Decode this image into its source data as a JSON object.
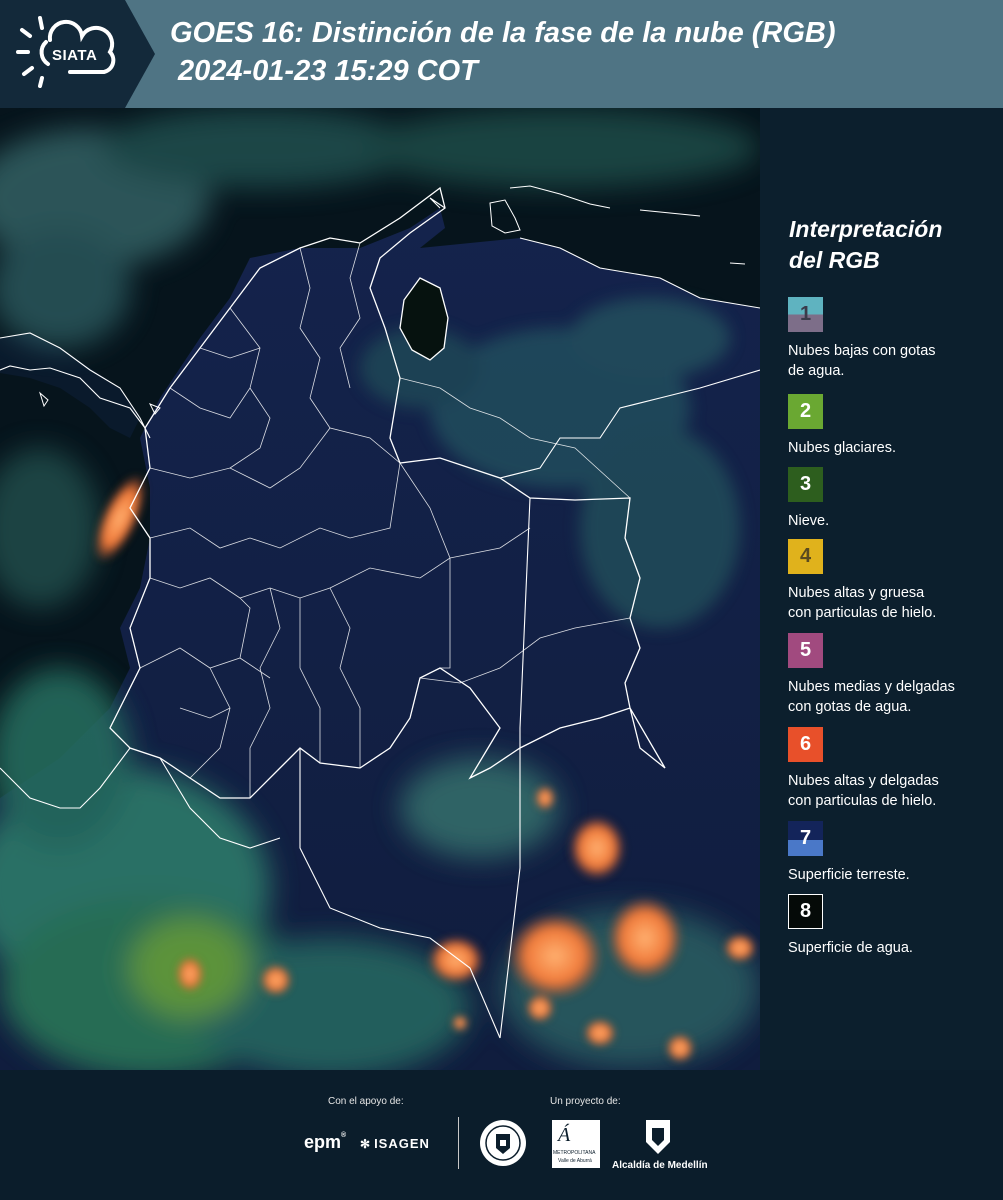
{
  "header": {
    "logo_text": "SIATA",
    "title_line1": "GOES 16: Distinción de la fase de la nube (RGB)",
    "title_line2": "2024-01-23 15:29 COT"
  },
  "legend": {
    "title_line1": "Interpretación",
    "title_line2": "del RGB",
    "items": [
      {
        "number": "1",
        "label_line1": "Nubes bajas con gotas",
        "label_line2": "de agua.",
        "color_top": "#5fb3c0",
        "color_bottom": "#7d6e89",
        "text_color": "#3a3a4a"
      },
      {
        "number": "2",
        "label_line1": "Nubes glaciares.",
        "label_line2": "",
        "color_top": "#6aa832",
        "color_bottom": "#6aa832",
        "text_color": "#ffffff"
      },
      {
        "number": "3",
        "label_line1": "Nieve.",
        "label_line2": "",
        "color_top": "#2d5e1e",
        "color_bottom": "#2d5e1e",
        "text_color": "#ffffff"
      },
      {
        "number": "4",
        "label_line1": "Nubes altas y gruesa",
        "label_line2": "con particulas de hielo.",
        "color_top": "#e0b21c",
        "color_bottom": "#e0b21c",
        "text_color": "#5a4a20"
      },
      {
        "number": "5",
        "label_line1": "Nubes medias y delgadas",
        "label_line2": "con gotas de agua.",
        "color_top": "#a14a7f",
        "color_bottom": "#a14a7f",
        "text_color": "#ffffff"
      },
      {
        "number": "6",
        "label_line1": "Nubes altas y delgadas",
        "label_line2": "con particulas de hielo.",
        "color_top": "#e8502a",
        "color_bottom": "#e8502a",
        "text_color": "#ffffff"
      },
      {
        "number": "7",
        "label_line1": "Superficie terreste.",
        "label_line2": "",
        "color_top": "#13245a",
        "color_bottom": "#4a78c8",
        "text_color": "#ffffff"
      },
      {
        "number": "8",
        "label_line1": "Superficie de agua.",
        "label_line2": "",
        "color_top": "#050a08",
        "color_bottom": "#050a08",
        "text_color": "#ffffff"
      }
    ]
  },
  "footer": {
    "support_label": "Con el apoyo de:",
    "project_label": "Un proyecto de:",
    "epm": "epm",
    "isagen": "ISAGEN",
    "area_metro": "METROPOLITANA",
    "area_metro_sub": "Valle de Aburrá",
    "alcaldia": "Alcaldía de Medellín"
  },
  "colors": {
    "header_bg": "#4f7484",
    "legend_bg": "#0c1f2d",
    "land": "#12204a",
    "ocean": "#06141c",
    "cloud_orange": "#f08a4a",
    "cloud_green": "#3c8a70",
    "boundary": "#ffffff"
  }
}
